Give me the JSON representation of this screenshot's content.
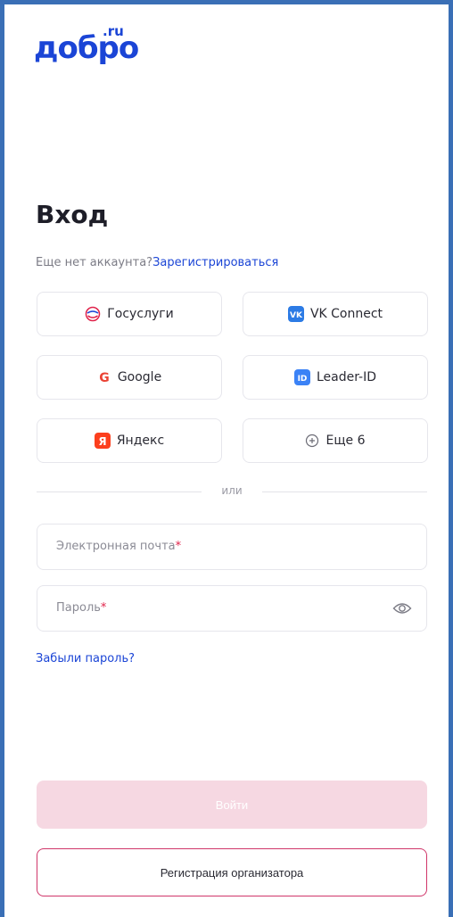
{
  "logo": {
    "main": "добро",
    "suffix": ".ru"
  },
  "title": "Вход",
  "register_prompt": {
    "text": "Еще нет аккаунта?",
    "link": "Зарегистрироваться"
  },
  "providers": [
    {
      "label": "Госуслуги",
      "icon": "gosuslugi-icon"
    },
    {
      "label": "VK Connect",
      "icon": "vk-icon"
    },
    {
      "label": "Google",
      "icon": "google-icon"
    },
    {
      "label": "Leader-ID",
      "icon": "leader-id-icon"
    },
    {
      "label": "Яндекс",
      "icon": "yandex-icon"
    },
    {
      "label": "Еще 6",
      "icon": "plus-circle-icon"
    }
  ],
  "divider": "или",
  "email": {
    "placeholder": "Электронная почта",
    "required_mark": "*"
  },
  "password": {
    "placeholder": "Пароль",
    "required_mark": "*"
  },
  "forgot_link": "Забыли пароль?",
  "login_button": "Войти",
  "org_button": "Регистрация организатора",
  "colors": {
    "brand": "#1b45d6",
    "frame": "#3a6fb6",
    "login_disabled": "#f6d8e2",
    "org_border": "#d0366a",
    "required": "#e0224a"
  }
}
